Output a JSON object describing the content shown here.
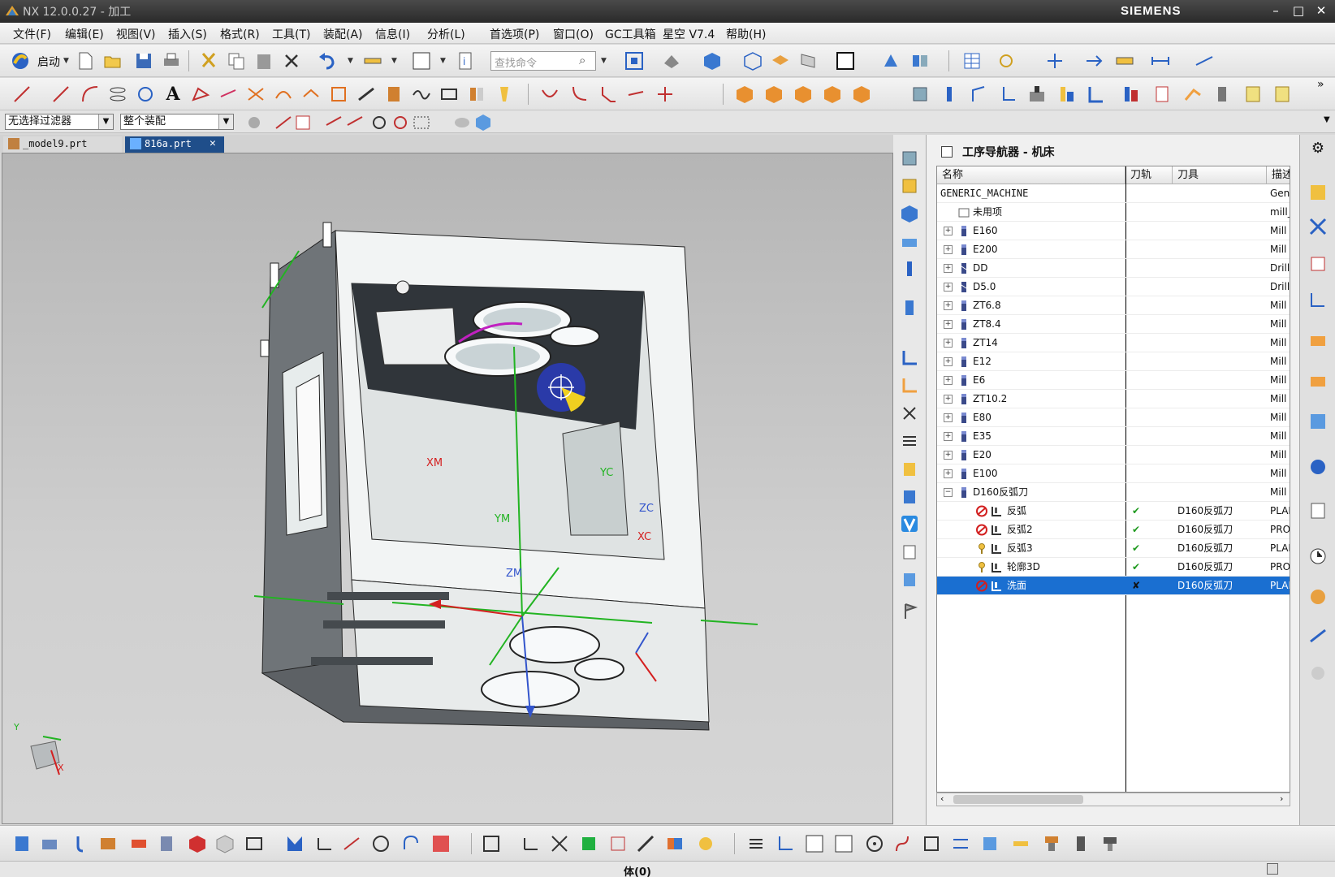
{
  "window": {
    "title": "NX 12.0.0.27 - 加工",
    "brand": "SIEMENS",
    "minimize": "–",
    "maximize": "□",
    "close": "✕"
  },
  "menu": [
    "文件(F)",
    "编辑(E)",
    "视图(V)",
    "插入(S)",
    "格式(R)",
    "工具(T)",
    "装配(A)",
    "信息(I)",
    "分析(L)",
    "首选项(P)",
    "窗口(O)",
    "GC工具箱",
    "星空 V7.4",
    "帮助(H)"
  ],
  "toolbar": {
    "start_label": "启动",
    "search_placeholder": "查找命令"
  },
  "filter": {
    "type_filter": "无选择过滤器",
    "scope": "整个装配"
  },
  "tabs": [
    {
      "label": "_model9.prt",
      "active": false
    },
    {
      "label": "816a.prt",
      "active": true
    }
  ],
  "viewport": {
    "csys_labels": {
      "xm": "XM",
      "ym": "YM",
      "zm": "ZM",
      "yc": "YC",
      "zc": "ZC",
      "xc": "XC"
    },
    "triad": {
      "y": "Y",
      "x": "X"
    }
  },
  "navigator": {
    "title": "工序导航器 - 机床",
    "columns": [
      "名称",
      "刀轨",
      "刀具",
      "描述"
    ],
    "rows": [
      {
        "name": "GENERIC_MACHINE",
        "level": 0,
        "icon": "none",
        "expander": "",
        "path": "",
        "tool": "",
        "desc": "Gener"
      },
      {
        "name": "未用项",
        "level": 1,
        "icon": "folder-icon",
        "expander": "",
        "path": "",
        "tool": "",
        "desc": "mill_"
      },
      {
        "name": "E160",
        "level": 1,
        "icon": "mill-tool-icon",
        "expander": "+",
        "path": "",
        "tool": "",
        "desc": "Mill"
      },
      {
        "name": "E200",
        "level": 1,
        "icon": "mill-tool-icon",
        "expander": "+",
        "path": "",
        "tool": "",
        "desc": "Mill"
      },
      {
        "name": "DD",
        "level": 1,
        "icon": "drill-tool-icon",
        "expander": "+",
        "path": "",
        "tool": "",
        "desc": "Drill"
      },
      {
        "name": "D5.0",
        "level": 1,
        "icon": "drill-tool-icon",
        "expander": "+",
        "path": "",
        "tool": "",
        "desc": "Drill"
      },
      {
        "name": "ZT6.8",
        "level": 1,
        "icon": "mill-tool-icon",
        "expander": "+",
        "path": "",
        "tool": "",
        "desc": "Mill"
      },
      {
        "name": "ZT8.4",
        "level": 1,
        "icon": "mill-tool-icon",
        "expander": "+",
        "path": "",
        "tool": "",
        "desc": "Mill"
      },
      {
        "name": "ZT14",
        "level": 1,
        "icon": "mill-tool-icon",
        "expander": "+",
        "path": "",
        "tool": "",
        "desc": "Mill"
      },
      {
        "name": "E12",
        "level": 1,
        "icon": "mill-tool-icon",
        "expander": "+",
        "path": "",
        "tool": "",
        "desc": "Mill"
      },
      {
        "name": "E6",
        "level": 1,
        "icon": "mill-tool-icon",
        "expander": "+",
        "path": "",
        "tool": "",
        "desc": "Mill"
      },
      {
        "name": "ZT10.2",
        "level": 1,
        "icon": "mill-tool-icon",
        "expander": "+",
        "path": "",
        "tool": "",
        "desc": "Mill"
      },
      {
        "name": "E80",
        "level": 1,
        "icon": "mill-tool-icon",
        "expander": "+",
        "path": "",
        "tool": "",
        "desc": "Mill"
      },
      {
        "name": "E35",
        "level": 1,
        "icon": "mill-tool-icon",
        "expander": "+",
        "path": "",
        "tool": "",
        "desc": "Mill"
      },
      {
        "name": "E20",
        "level": 1,
        "icon": "mill-tool-icon",
        "expander": "+",
        "path": "",
        "tool": "",
        "desc": "Mill"
      },
      {
        "name": "E100",
        "level": 1,
        "icon": "mill-tool-icon",
        "expander": "+",
        "path": "",
        "tool": "",
        "desc": "Mill"
      },
      {
        "name": "D160反弧刀",
        "level": 1,
        "icon": "mill-tool-icon",
        "expander": "−",
        "path": "",
        "tool": "",
        "desc": "Mill"
      },
      {
        "name": "反弧",
        "level": 2,
        "icon": "op-prohibited-icon",
        "expander": "",
        "path": "✔",
        "tool": "D160反弧刀",
        "desc": "PLAN"
      },
      {
        "name": "反弧2",
        "level": 2,
        "icon": "op-prohibited-icon",
        "expander": "",
        "path": "✔",
        "tool": "D160反弧刀",
        "desc": "PROF"
      },
      {
        "name": "反弧3",
        "level": 2,
        "icon": "op-complete-icon",
        "expander": "",
        "path": "✔",
        "tool": "D160反弧刀",
        "desc": "PLAN"
      },
      {
        "name": "轮廓3D",
        "level": 2,
        "icon": "op-complete-icon",
        "expander": "",
        "path": "✔",
        "tool": "D160反弧刀",
        "desc": "PROF"
      },
      {
        "name": "洗面",
        "level": 2,
        "icon": "op-prohibited-icon",
        "expander": "",
        "path": "✘",
        "tool": "D160反弧刀",
        "desc": "PLAN",
        "selected": true
      }
    ]
  },
  "status": {
    "text": "体(0)"
  },
  "colors": {
    "selection": "#1a6fd1",
    "check": "#1f9a1f",
    "prohibited": "#d21f1f",
    "axis_x": "#d42020",
    "axis_y": "#22b422",
    "axis_z": "#3355cc"
  }
}
